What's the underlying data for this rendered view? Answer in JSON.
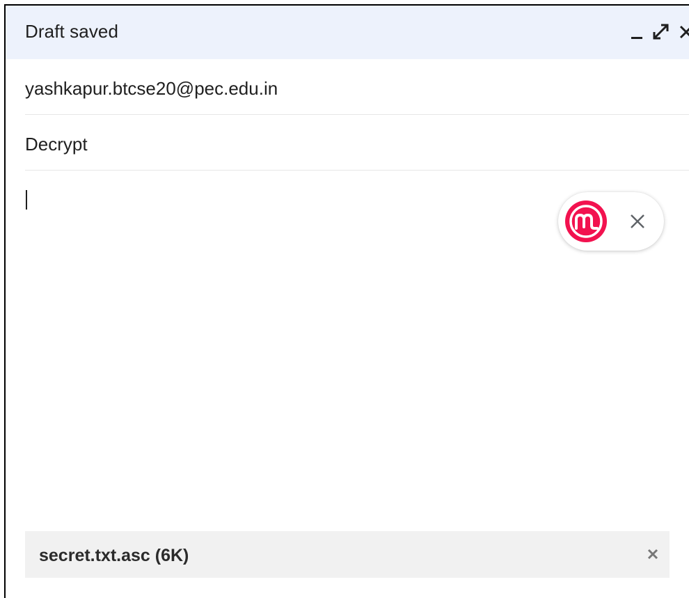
{
  "header": {
    "title": "Draft saved",
    "controls": {
      "minimize_icon": "minimize-icon",
      "expand_icon": "expand-icon",
      "close_icon": "close-icon"
    }
  },
  "to": {
    "value": "yashkapur.btcse20@pec.edu.in"
  },
  "subject": {
    "value": "Decrypt"
  },
  "body": {
    "value": ""
  },
  "extension": {
    "logo_icon": "mailmeteor-logo-icon",
    "close_icon": "close-icon",
    "brand_color": "#f2124f"
  },
  "attachment": {
    "name": "secret.txt.asc (6K)",
    "remove_icon": "close-icon"
  },
  "colors": {
    "header_bg": "#edf2fc",
    "text": "#1f1f1f",
    "attachment_bg": "#f1f1f1"
  }
}
